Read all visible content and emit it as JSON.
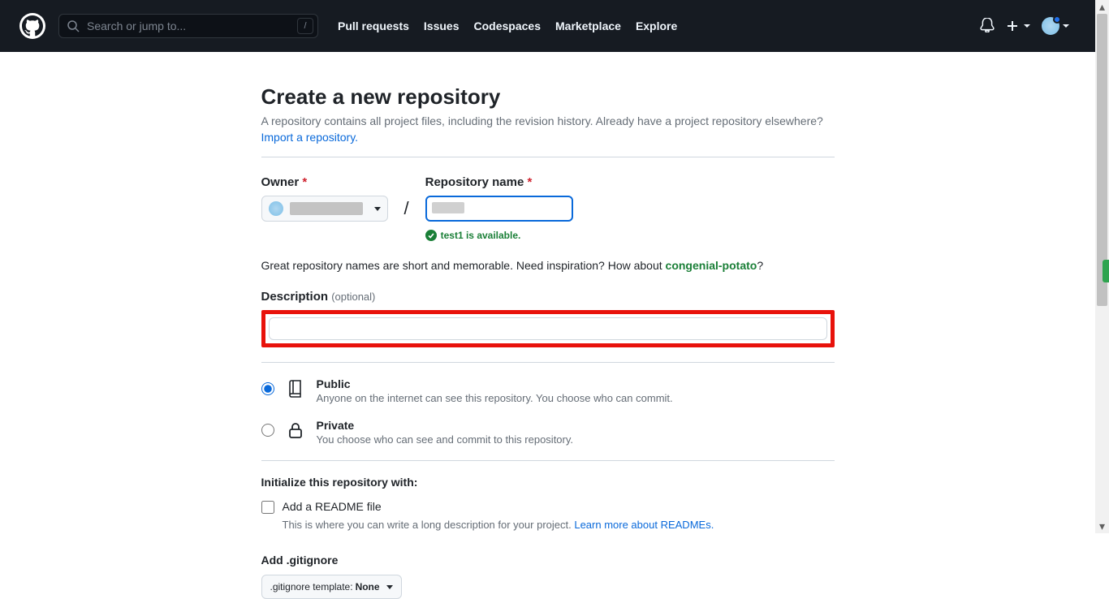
{
  "header": {
    "search_placeholder": "Search or jump to...",
    "slash_key": "/",
    "nav": {
      "pulls": "Pull requests",
      "issues": "Issues",
      "codespaces": "Codespaces",
      "marketplace": "Marketplace",
      "explore": "Explore"
    }
  },
  "page": {
    "title": "Create a new repository",
    "subtitle": "A repository contains all project files, including the revision history. Already have a project repository elsewhere?",
    "import_link": "Import a repository.",
    "owner_label": "Owner",
    "repo_label": "Repository name",
    "separator": "/",
    "available_msg": "test1 is available.",
    "inspire_text": "Great repository names are short and memorable. Need inspiration? How about ",
    "suggestion": "congenial-potato",
    "inspire_q": "?",
    "description_label": "Description",
    "optional_text": "(optional)",
    "visibility": {
      "public": {
        "title": "Public",
        "hint": "Anyone on the internet can see this repository. You choose who can commit."
      },
      "private": {
        "title": "Private",
        "hint": "You choose who can see and commit to this repository."
      }
    },
    "init_title": "Initialize this repository with:",
    "readme_label": "Add a README file",
    "readme_hint_text": "This is where you can write a long description for your project. ",
    "readme_learn": "Learn more about READMEs.",
    "gitignore_label": "Add .gitignore",
    "gitignore_template_label": ".gitignore template:",
    "gitignore_value": "None"
  }
}
